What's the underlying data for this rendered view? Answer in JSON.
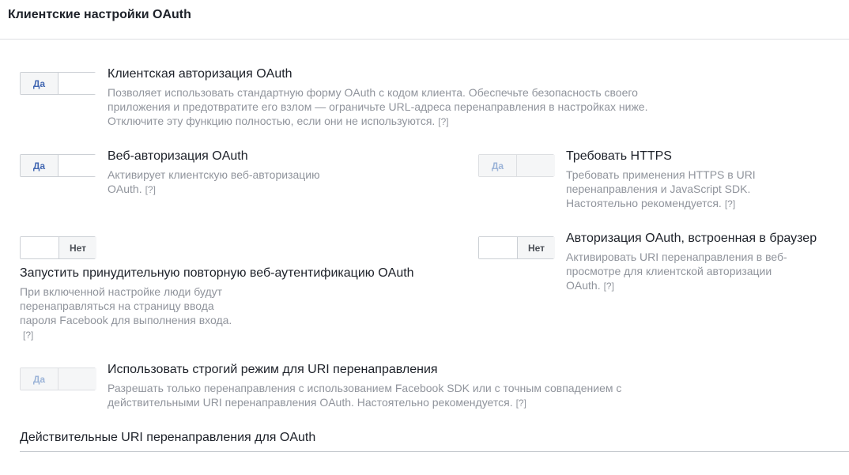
{
  "header": {
    "title": "Клиентские настройки OAuth"
  },
  "settings": {
    "client_oauth": {
      "toggle": "Да",
      "title": "Клиентская авторизация OAuth",
      "desc_lines": [
        "Позволяет использовать стандартную форму OAuth с кодом клиента. Обеспечьте безопасность своего",
        "приложения и предотвратите его взлом — ограничьте URL-адреса перенаправления в настройках ниже.",
        "Отключите эту функцию полностью, если они не используются."
      ],
      "help": "[?]"
    },
    "web_oauth": {
      "toggle": "Да",
      "title": "Веб-авторизация OAuth",
      "desc_lines": [
        "Активирует клиентскую веб-авторизацию",
        "OAuth."
      ],
      "help": "[?]"
    },
    "require_https": {
      "toggle": "Да",
      "title": "Требовать HTTPS",
      "desc_lines": [
        "Требовать применения HTTPS в URI",
        "перенаправления и JavaScript SDK.",
        "Настоятельно рекомендуется."
      ],
      "help": "[?]"
    },
    "force_reauth": {
      "toggle": "Нет",
      "title": "Запустить принудительную повторную веб-аутентификацию OAuth",
      "desc_lines": [
        "При включенной настройке люди будут",
        "перенаправляться на страницу ввода",
        "пароля Facebook для выполнения входа."
      ],
      "help": "[?]"
    },
    "embedded_browser": {
      "toggle": "Нет",
      "title": "Авторизация OAuth, встроенная в браузер",
      "desc_lines": [
        "Активировать URI перенаправления в веб-",
        "просмотре для клиентской авторизации",
        "OAuth."
      ],
      "help": "[?]"
    },
    "strict_mode": {
      "toggle": "Да",
      "title": "Использовать строгий режим для URI перенаправления",
      "desc_lines": [
        "Разрешать только перенаправления с использованием Facebook SDK или с точным совпадением с",
        "действительными URI перенаправления OAuth. Настоятельно рекомендуется."
      ],
      "help": "[?]"
    }
  },
  "redirect_uris": {
    "title": "Действительные URI перенаправления для OAuth"
  }
}
